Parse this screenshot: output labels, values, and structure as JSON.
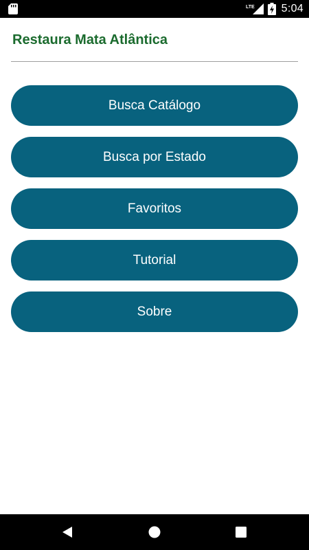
{
  "status_bar": {
    "network_label": "LTE",
    "time": "5:04",
    "icons": [
      "sd-card-icon",
      "lte-signal-icon",
      "battery-charging-icon"
    ]
  },
  "app": {
    "title": "Restaura Mata Atlântica",
    "title_color": "#1b6b2e"
  },
  "menu": {
    "button_color": "#08627e",
    "items": [
      {
        "label": "Busca Catálogo"
      },
      {
        "label": "Busca por Estado"
      },
      {
        "label": "Favoritos"
      },
      {
        "label": "Tutorial"
      },
      {
        "label": "Sobre"
      }
    ]
  },
  "nav_bar": {
    "icons": [
      "back-icon",
      "home-icon",
      "recents-icon"
    ]
  }
}
